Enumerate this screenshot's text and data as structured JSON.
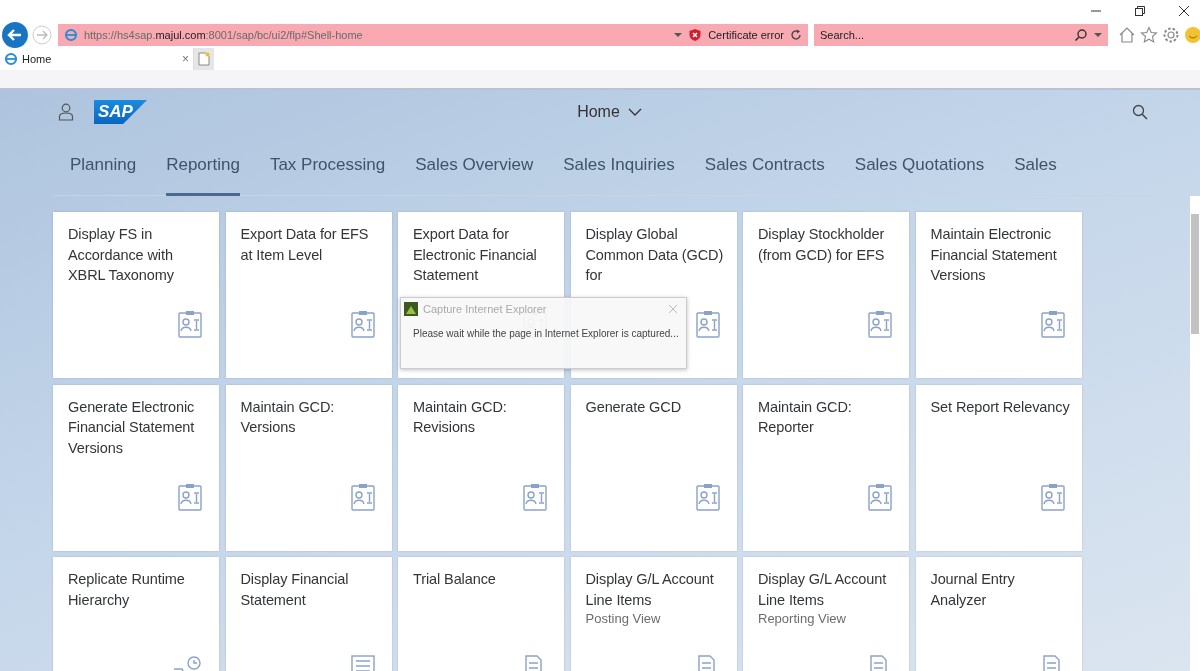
{
  "browser": {
    "url_prefix": "https://hs4sap.",
    "url_host": "majul.com",
    "url_rest": ":8001/sap/bc/ui2/flp#Shell-home",
    "certificate": "Certificate error",
    "search": {
      "placeholder": "Search..."
    },
    "tab": {
      "label": "Home",
      "close": "×"
    }
  },
  "shell": {
    "logo": "SAP",
    "title": "Home"
  },
  "tabs": [
    {
      "label": "Planning",
      "selected": false
    },
    {
      "label": "Reporting",
      "selected": true
    },
    {
      "label": "Tax Processing",
      "selected": false
    },
    {
      "label": "Sales Overview",
      "selected": false
    },
    {
      "label": "Sales Inquiries",
      "selected": false
    },
    {
      "label": "Sales Contracts",
      "selected": false
    },
    {
      "label": "Sales Quotations",
      "selected": false
    },
    {
      "label": "Sales",
      "selected": false
    }
  ],
  "tiles": [
    {
      "title": "Display FS in Accordance with XBRL Taxonomy",
      "kind": "card"
    },
    {
      "title": "Export Data for EFS at Item Level",
      "kind": "card"
    },
    {
      "title": "Export Data for Electronic Financial Statement",
      "kind": "card"
    },
    {
      "title": "Display Global Common Data (GCD) for",
      "kind": "card"
    },
    {
      "title": "Display Stockholder (from GCD) for EFS",
      "kind": "card"
    },
    {
      "title": "Maintain Electronic Financial Statement Versions",
      "kind": "card"
    },
    {
      "title": "Generate Electronic Financial Statement Versions",
      "kind": "card"
    },
    {
      "title": "Maintain GCD: Versions",
      "kind": "card"
    },
    {
      "title": "Maintain GCD: Revisions",
      "kind": "card"
    },
    {
      "title": "Generate GCD",
      "kind": "card"
    },
    {
      "title": "Maintain GCD: Reporter",
      "kind": "card"
    },
    {
      "title": "Set Report Relevancy",
      "kind": "card"
    },
    {
      "title": "Replicate Runtime Hierarchy",
      "kind": "hierarchy"
    },
    {
      "title": "Display Financial Statement",
      "kind": "statement"
    },
    {
      "title": "Trial Balance",
      "kind": "report"
    },
    {
      "title": "Display G/L Account Line Items",
      "subtitle": "Posting View",
      "kind": "report"
    },
    {
      "title": "Display G/L Account Line Items",
      "subtitle": "Reporting View",
      "kind": "report"
    },
    {
      "title": "Journal Entry Analyzer",
      "kind": "report"
    }
  ],
  "dialog": {
    "title": "Capture Internet Explorer",
    "message": "Please wait while the page in Internet Explorer is captured..."
  }
}
